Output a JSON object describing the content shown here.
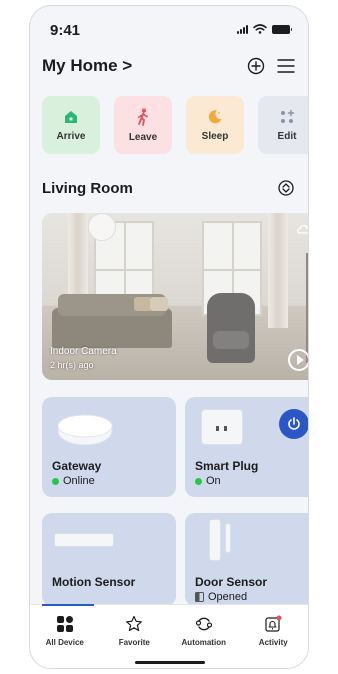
{
  "status_bar": {
    "time": "9:41"
  },
  "header": {
    "home_title": "My Home >"
  },
  "scenes": [
    {
      "label": "Arrive",
      "icon": "home-icon",
      "color": "#2bb673"
    },
    {
      "label": "Leave",
      "icon": "walking-person-icon",
      "color": "#e8505b"
    },
    {
      "label": "Sleep",
      "icon": "moon-icon",
      "color": "#f2a93b"
    },
    {
      "label": "Edit",
      "icon": "grid-add-icon",
      "color": "#8a93a6"
    }
  ],
  "room": {
    "title": "Living Room"
  },
  "camera": {
    "name": "Indoor Camera",
    "time_ago": "2 hr(s) ago"
  },
  "devices": [
    {
      "name": "Gateway",
      "status": "Online"
    },
    {
      "name": "Smart Plug",
      "status": "On"
    },
    {
      "name": "Motion Sensor",
      "status": ""
    },
    {
      "name": "Door Sensor",
      "status": "Opened"
    }
  ],
  "tabbar": {
    "tabs": [
      {
        "label": "All Device",
        "icon": "devices-icon"
      },
      {
        "label": "Favorite",
        "icon": "star-icon"
      },
      {
        "label": "Automation",
        "icon": "automation-icon"
      },
      {
        "label": "Activity",
        "icon": "bell-icon"
      }
    ]
  },
  "colors": {
    "accent": "#2a56c6",
    "online": "#29c54a",
    "card": "#cfd9eb"
  }
}
